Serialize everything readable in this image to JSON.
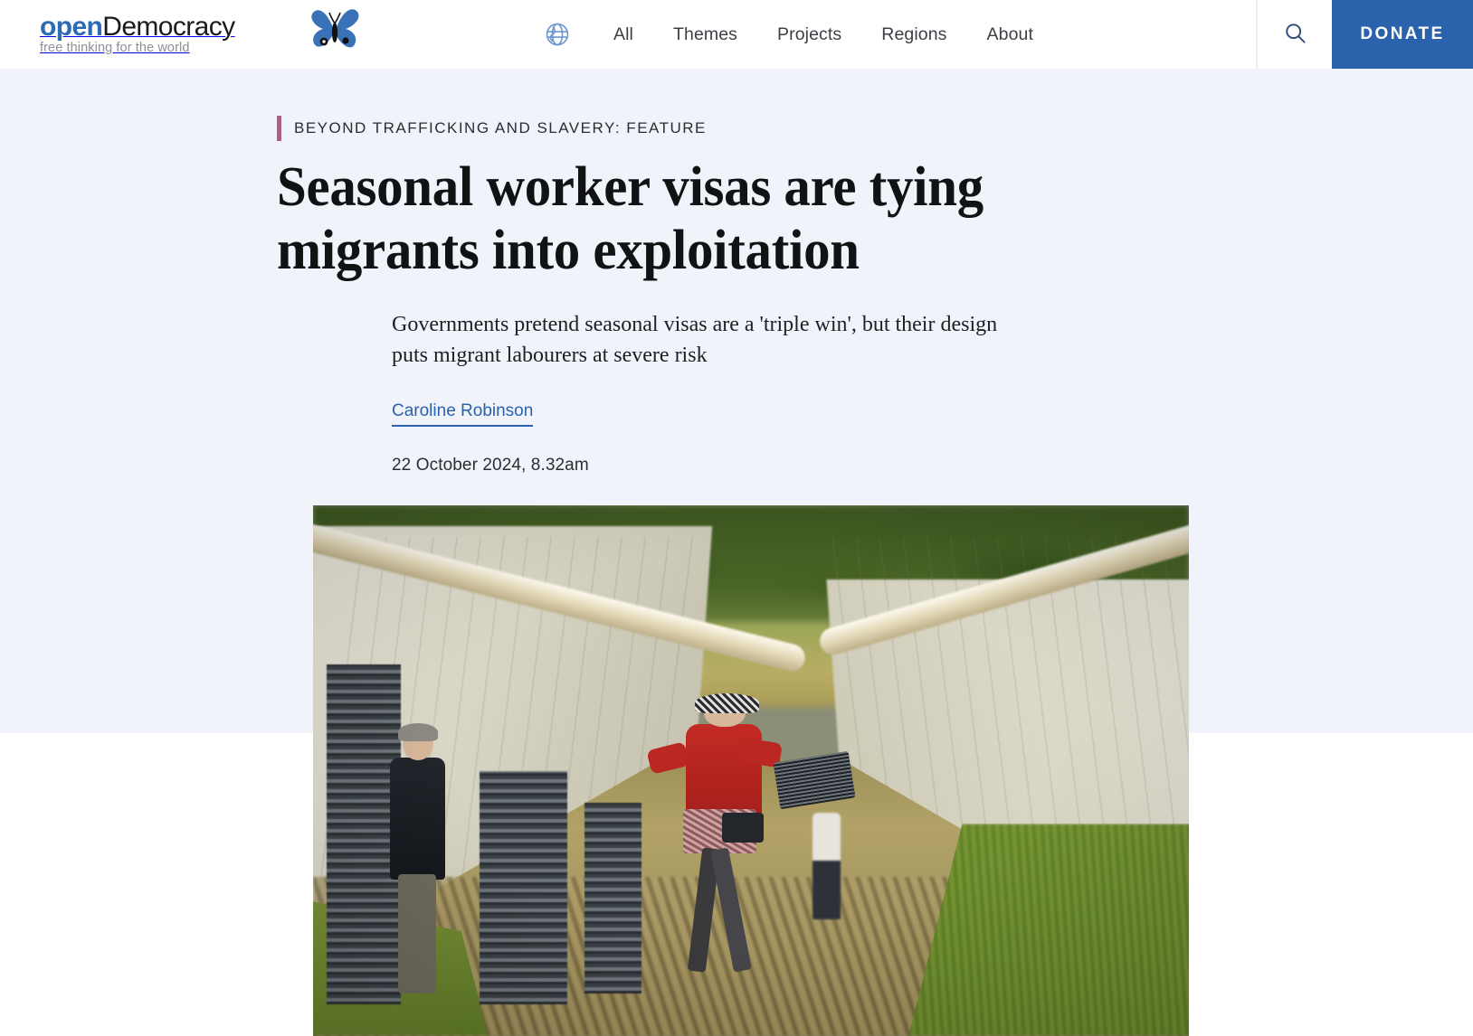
{
  "site": {
    "brand_open": "open",
    "brand_democracy": "Democracy",
    "tagline": "free thinking for the world",
    "logo_icon": "butterfly-logo",
    "accent_blue": "#2a62ab",
    "band_background": "#f0f3f9"
  },
  "nav": {
    "globe_icon": "globe-icon",
    "items": [
      {
        "label": "All"
      },
      {
        "label": "Themes"
      },
      {
        "label": "Projects"
      },
      {
        "label": "Regions"
      },
      {
        "label": "About"
      }
    ],
    "search_icon": "search-icon",
    "donate_label": "DONATE"
  },
  "article": {
    "kicker": "BEYOND TRAFFICKING AND SLAVERY: FEATURE",
    "kicker_bar_color": "#a4647f",
    "headline": "Seasonal worker visas are tying migrants into exploitation",
    "standfirst": "Governments pretend seasonal visas are a 'triple win', but their design puts migrant labourers at severe risk",
    "author": "Caroline Robinson",
    "published": "22 October 2024, 8.32am",
    "hero_image_alt": "Farm workers carrying crates along a muddy track between white polytunnels on a fruit farm"
  }
}
